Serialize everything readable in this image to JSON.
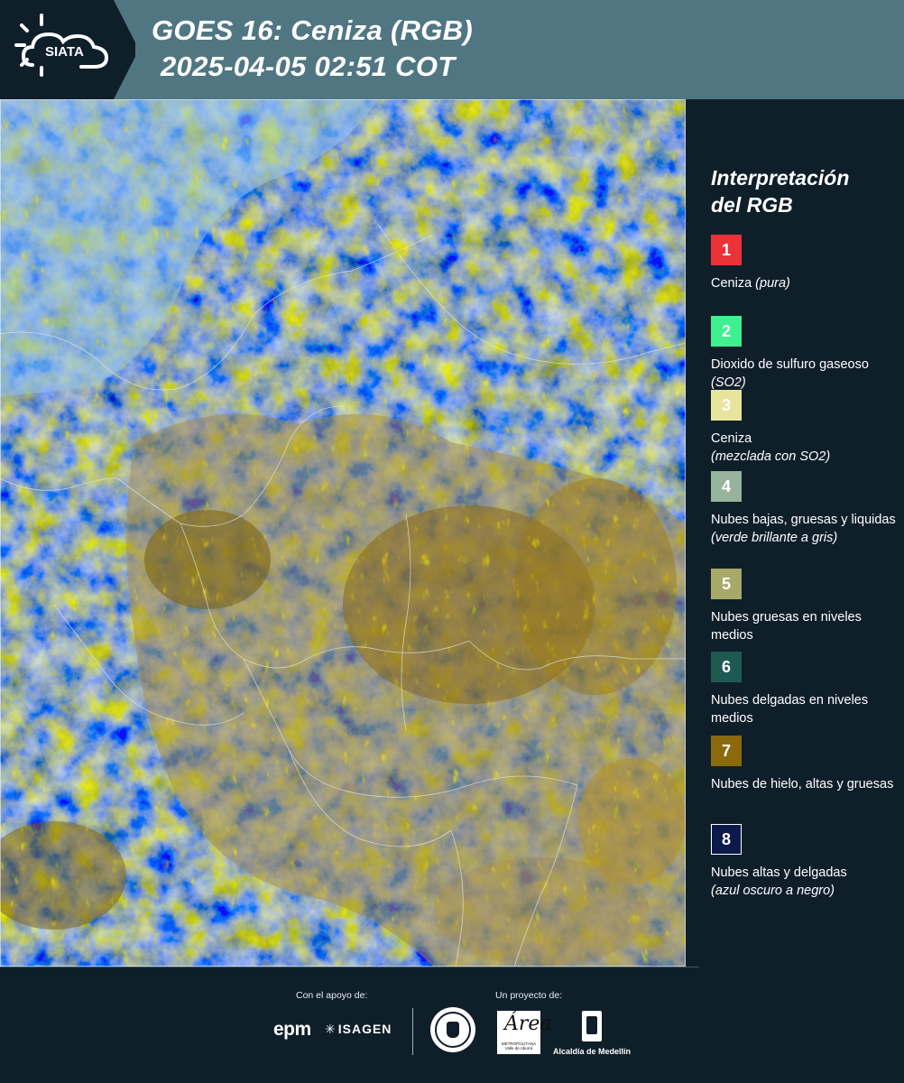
{
  "header": {
    "logo_text": "SIATA",
    "title_line1": "GOES 16: Ceniza (RGB)",
    "title_line2": "2025-04-05 02:51 COT",
    "bg_color": "#507682"
  },
  "map": {
    "description_icon": "satellite-rgb-ash-composite"
  },
  "legend": {
    "title_line1": "Interpretación",
    "title_line2": "del RGB",
    "items": [
      {
        "number": "1",
        "color": "#ec3237",
        "text": "Ceniza",
        "text_italic": "(pura)"
      },
      {
        "number": "2",
        "color": "#3ff08e",
        "text": "Dioxido de sulfuro gaseoso",
        "text_italic": "(SO2)"
      },
      {
        "number": "3",
        "color": "#e8e49c",
        "text": "Ceniza",
        "text_italic": "(mezclada con SO2)"
      },
      {
        "number": "4",
        "color": "#98b39b",
        "text": "Nubes bajas, gruesas y liquidas",
        "text_italic": "(verde brillante a gris)"
      },
      {
        "number": "5",
        "color": "#a8a86a",
        "text": "Nubes gruesas en niveles medios",
        "text_italic": ""
      },
      {
        "number": "6",
        "color": "#1f5a52",
        "text": "Nubes delgadas en niveles medios",
        "text_italic": ""
      },
      {
        "number": "7",
        "color": "#8a6a0d",
        "text": "Nubes de hielo, altas y gruesas",
        "text_italic": ""
      },
      {
        "number": "8",
        "color": "#0b1a4a",
        "text": "Nubes altas y delgadas",
        "text_italic": "(azul oscuro a negro)"
      }
    ]
  },
  "footer": {
    "support_label": "Con el apoyo de:",
    "project_label": "Un proyecto de:",
    "sponsor1": "epm",
    "sponsor2": "ISAGEN",
    "area_big": "Área",
    "area_small": "METROPOLITANA Valle de Aburrá",
    "alcaldia": "Alcaldía de Medellín"
  }
}
